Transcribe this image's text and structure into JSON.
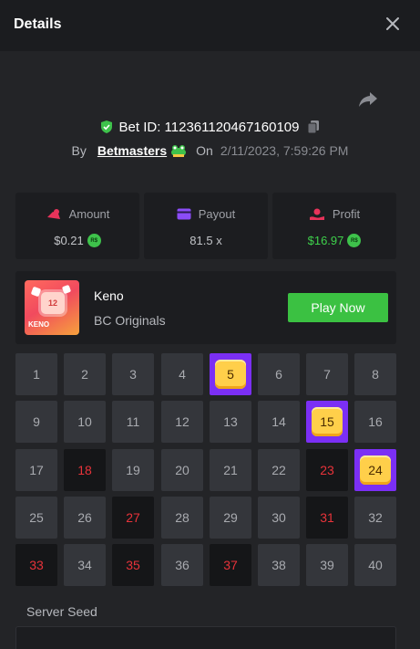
{
  "header": {
    "title": "Details",
    "close_icon": "close-icon"
  },
  "share": {
    "icon": "share-icon"
  },
  "bet": {
    "id_text": "Bet ID: 112361120467160109",
    "by_label": "By",
    "user": "Betmasters",
    "on_label": "On",
    "date": "2/11/2023, 7:59:26 PM"
  },
  "stats": {
    "amount": {
      "label": "Amount",
      "value": "$0.21",
      "icon": "amount-icon"
    },
    "payout": {
      "label": "Payout",
      "value": "81.5 x",
      "icon": "card-icon"
    },
    "profit": {
      "label": "Profit",
      "value": "$16.97",
      "icon": "profit-icon"
    }
  },
  "game": {
    "name": "Keno",
    "provider": "BC Originals",
    "play_label": "Play Now",
    "thumb_number": "12",
    "thumb_text": "KENO"
  },
  "keno": {
    "cells": [
      {
        "n": "1",
        "s": "normal"
      },
      {
        "n": "2",
        "s": "normal"
      },
      {
        "n": "3",
        "s": "normal"
      },
      {
        "n": "4",
        "s": "normal"
      },
      {
        "n": "5",
        "s": "hit"
      },
      {
        "n": "6",
        "s": "normal"
      },
      {
        "n": "7",
        "s": "normal"
      },
      {
        "n": "8",
        "s": "normal"
      },
      {
        "n": "9",
        "s": "normal"
      },
      {
        "n": "10",
        "s": "normal"
      },
      {
        "n": "11",
        "s": "normal"
      },
      {
        "n": "12",
        "s": "normal"
      },
      {
        "n": "13",
        "s": "normal"
      },
      {
        "n": "14",
        "s": "normal"
      },
      {
        "n": "15",
        "s": "hit"
      },
      {
        "n": "16",
        "s": "normal"
      },
      {
        "n": "17",
        "s": "normal"
      },
      {
        "n": "18",
        "s": "miss"
      },
      {
        "n": "19",
        "s": "normal"
      },
      {
        "n": "20",
        "s": "normal"
      },
      {
        "n": "21",
        "s": "normal"
      },
      {
        "n": "22",
        "s": "normal"
      },
      {
        "n": "23",
        "s": "miss"
      },
      {
        "n": "24",
        "s": "hit"
      },
      {
        "n": "25",
        "s": "normal"
      },
      {
        "n": "26",
        "s": "normal"
      },
      {
        "n": "27",
        "s": "miss"
      },
      {
        "n": "28",
        "s": "normal"
      },
      {
        "n": "29",
        "s": "normal"
      },
      {
        "n": "30",
        "s": "normal"
      },
      {
        "n": "31",
        "s": "miss"
      },
      {
        "n": "32",
        "s": "normal"
      },
      {
        "n": "33",
        "s": "miss"
      },
      {
        "n": "34",
        "s": "normal"
      },
      {
        "n": "35",
        "s": "miss"
      },
      {
        "n": "36",
        "s": "normal"
      },
      {
        "n": "37",
        "s": "miss"
      },
      {
        "n": "38",
        "s": "normal"
      },
      {
        "n": "39",
        "s": "normal"
      },
      {
        "n": "40",
        "s": "normal"
      }
    ]
  },
  "seed": {
    "label": "Server Seed"
  },
  "colors": {
    "accent_green": "#3bc142",
    "hit_purple": "#7b2ff5",
    "miss_red": "#e8333a",
    "gem_yellow": "#ffcf4a"
  }
}
